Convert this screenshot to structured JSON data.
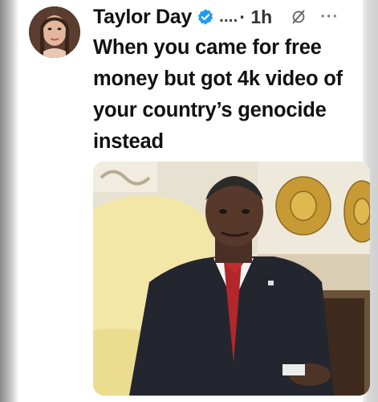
{
  "post": {
    "author_name": "Taylor Day",
    "handle": "....",
    "time": "· 1h",
    "more_label": "···",
    "text": "When you came for free money but got 4k video of your country’s genocide instead",
    "icons": {
      "verified": "verified-check-icon",
      "grok": "grok-slash-icon",
      "more": "more-options-icon"
    },
    "colors": {
      "verified": "#1d9bf0",
      "text": "#111111"
    }
  }
}
